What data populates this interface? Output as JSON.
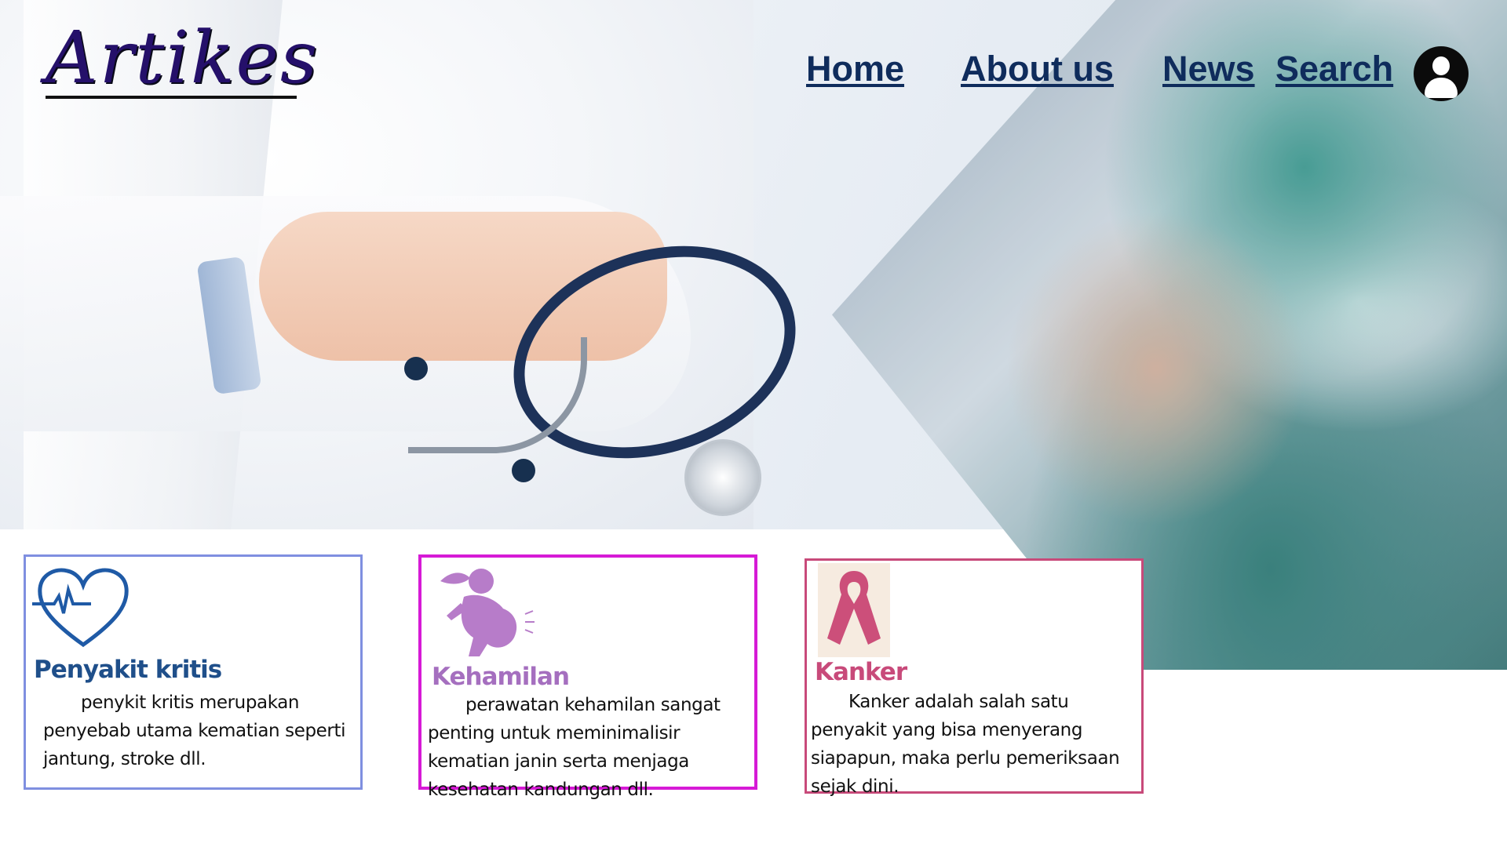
{
  "header": {
    "logo": "Artikes",
    "nav": {
      "home": "Home",
      "about": "About us",
      "news": "News",
      "search": "Search"
    },
    "profile_icon": "user-circle-icon"
  },
  "hero": {
    "left_image": "doctor-with-stethoscope-photo",
    "right_image": "medical-staff-in-masks-photo"
  },
  "cards": [
    {
      "title": "Penyakit kritis",
      "text": "penykit kritis merupakan penyebab utama kematian seperti jantung, stroke dll.",
      "icon": "heart-pulse-icon",
      "accent": "#7f8fe0",
      "title_color": "#1f4f8a"
    },
    {
      "title": "Kehamilan",
      "text": "perawatan  kehamilan sangat penting untuk meminimalisir kematian janin serta menjaga kesehatan kandungan dll.",
      "icon": "pregnant-woman-icon",
      "accent": "#d61ad6",
      "title_color": "#a56fbf"
    },
    {
      "title": "Kanker",
      "text": "Kanker adalah salah satu penyakit yang bisa menyerang siapapun, maka perlu pemeriksaan sejak dini.",
      "icon": "awareness-ribbon-icon",
      "accent": "#c84a7a",
      "title_color": "#c84a7a"
    }
  ]
}
